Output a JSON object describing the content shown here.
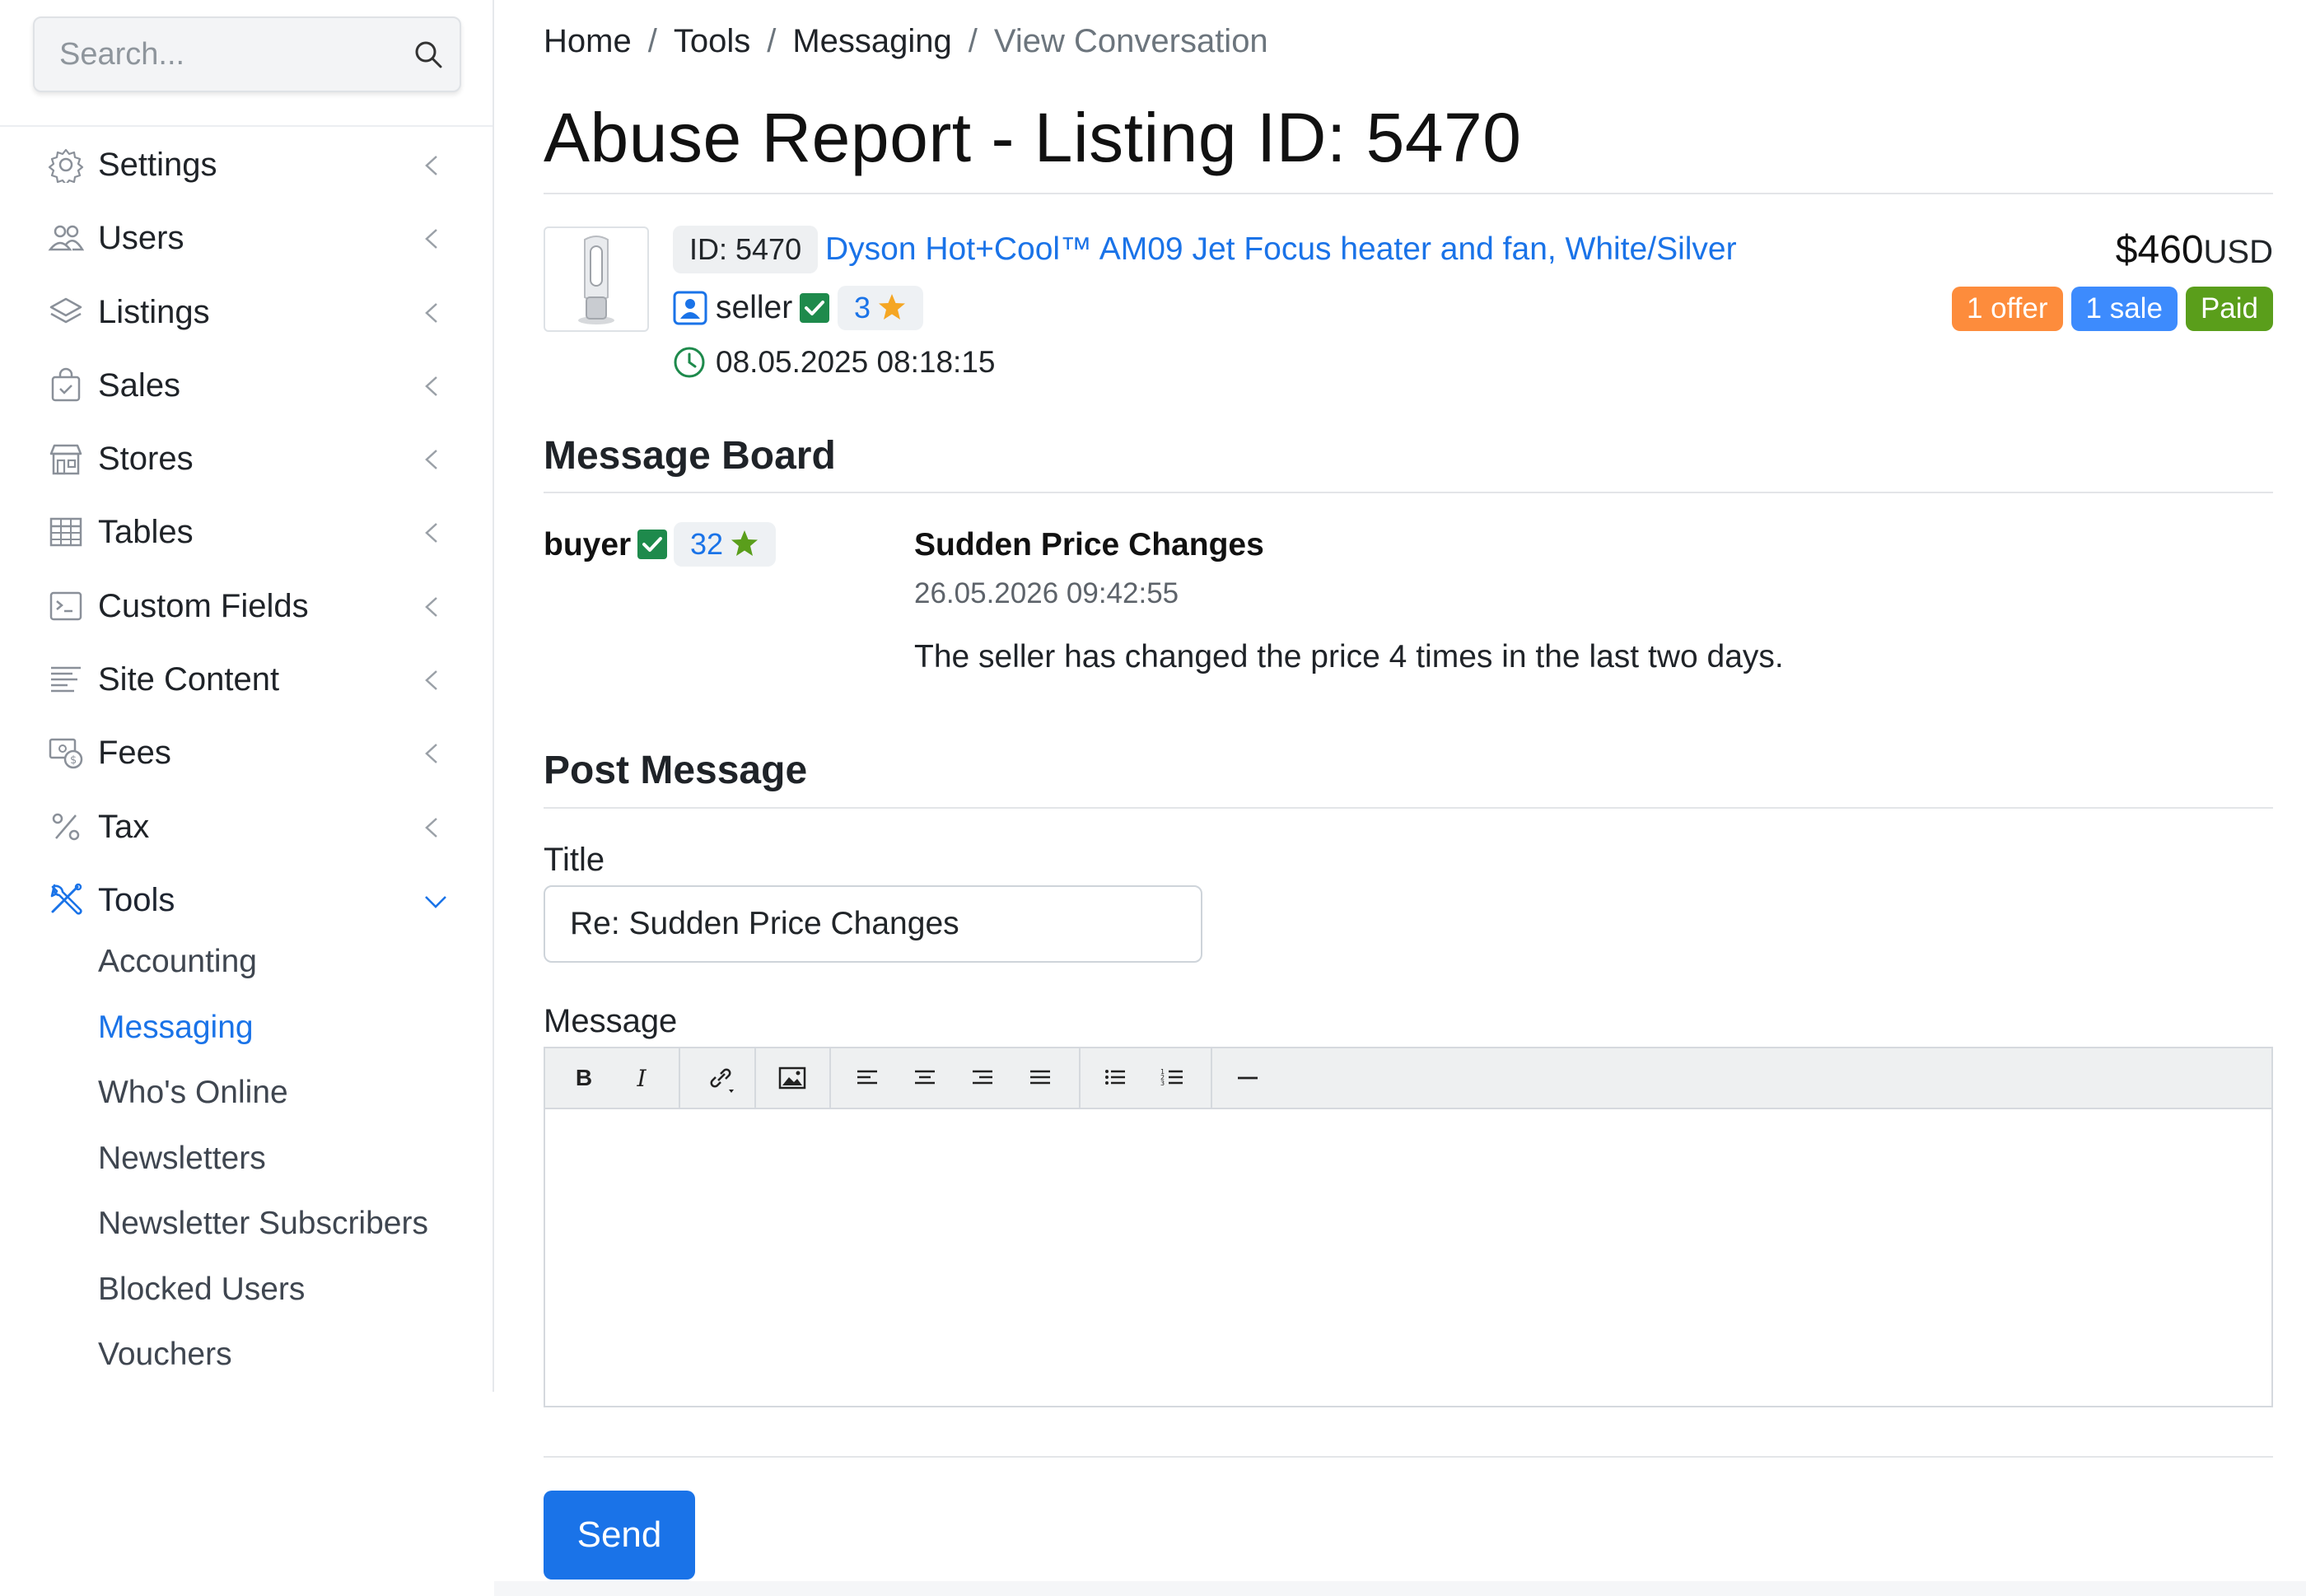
{
  "search": {
    "placeholder": "Search..."
  },
  "sidebar": {
    "items": [
      {
        "label": "Settings",
        "icon": "gear-icon"
      },
      {
        "label": "Users",
        "icon": "users-icon"
      },
      {
        "label": "Listings",
        "icon": "layers-icon"
      },
      {
        "label": "Sales",
        "icon": "shopping-bag-icon"
      },
      {
        "label": "Stores",
        "icon": "store-icon"
      },
      {
        "label": "Tables",
        "icon": "table-icon"
      },
      {
        "label": "Custom Fields",
        "icon": "terminal-icon"
      },
      {
        "label": "Site Content",
        "icon": "text-lines-icon"
      },
      {
        "label": "Fees",
        "icon": "money-icon"
      },
      {
        "label": "Tax",
        "icon": "percent-icon"
      },
      {
        "label": "Tools",
        "icon": "tools-icon"
      }
    ],
    "tools_sub": [
      {
        "label": "Accounting"
      },
      {
        "label": "Messaging"
      },
      {
        "label": "Who's Online"
      },
      {
        "label": "Newsletters"
      },
      {
        "label": "Newsletter Subscribers"
      },
      {
        "label": "Blocked Users"
      },
      {
        "label": "Vouchers"
      }
    ]
  },
  "breadcrumb": [
    "Home",
    "Tools",
    "Messaging",
    "View Conversation"
  ],
  "page_title": "Abuse Report - Listing ID: 5470",
  "listing": {
    "id_label": "ID: 5470",
    "title": "Dyson Hot+Cool™ AM09 Jet Focus heater and fan, White/Silver",
    "seller": "seller",
    "seller_rating": "3",
    "date": "08.05.2025 08:18:15",
    "price": "$460",
    "currency": "USD",
    "badges": [
      {
        "label": "1 offer",
        "color": "#fd8c3c"
      },
      {
        "label": "1 sale",
        "color": "#3d8bfd"
      },
      {
        "label": "Paid",
        "color": "#5a9e1b"
      }
    ]
  },
  "message_board": {
    "heading": "Message Board",
    "author": "buyer",
    "author_rating": "32",
    "subject": "Sudden Price Changes",
    "date": "26.05.2026 09:42:55",
    "body": "The seller has changed the price 4 times in the last two days."
  },
  "post": {
    "heading": "Post Message",
    "title_label": "Title",
    "title_value": "Re: Sudden Price Changes",
    "message_label": "Message",
    "send_label": "Send"
  },
  "colors": {
    "accent": "#1a73e8",
    "check_green": "#1e8a4c",
    "star_orange": "#f5a623",
    "star_green": "#5a9e1b"
  }
}
